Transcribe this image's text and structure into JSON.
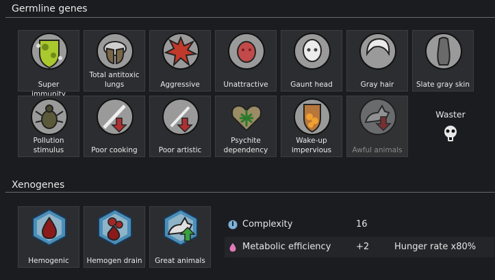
{
  "germline": {
    "title": "Germline genes",
    "genes": [
      {
        "label": "Super immunity",
        "icon": "shield-icon"
      },
      {
        "label": "Total antitoxic lungs",
        "icon": "lungs-icon"
      },
      {
        "label": "Aggressive",
        "icon": "burst-icon"
      },
      {
        "label": "Unattractive",
        "icon": "face-icon"
      },
      {
        "label": "Gaunt head",
        "icon": "skull-icon"
      },
      {
        "label": "Gray hair",
        "icon": "hair-icon"
      },
      {
        "label": "Slate gray skin",
        "icon": "body-icon"
      },
      {
        "label": "Pollution stimulus",
        "icon": "beetle-icon"
      },
      {
        "label": "Poor cooking",
        "icon": "cooking-down-icon"
      },
      {
        "label": "Poor artistic",
        "icon": "artistic-down-icon"
      },
      {
        "label": "Psychite dependency",
        "icon": "leaf-heart-icon"
      },
      {
        "label": "Wake-up impervious",
        "icon": "pills-shield-icon"
      },
      {
        "label": "Awful animals",
        "icon": "animal-down-icon"
      }
    ],
    "waster": {
      "label": "Waster",
      "icon": "gas-mask-icon"
    }
  },
  "xenogenes": {
    "title": "Xenogenes",
    "genes": [
      {
        "label": "Hemogenic",
        "icon": "blood-drop-icon"
      },
      {
        "label": "Hemogen drain",
        "icon": "blood-cells-icon"
      },
      {
        "label": "Great animals",
        "icon": "animal-up-icon"
      }
    ]
  },
  "stats": [
    {
      "name": "Complexity",
      "value": "16",
      "extra": "",
      "icon": "complexity-icon",
      "color": "#7fb0d8"
    },
    {
      "name": "Metabolic efficiency",
      "value": "+2",
      "extra": "Hunger rate x80%",
      "icon": "metabolism-icon",
      "color": "#e07ab8"
    }
  ]
}
